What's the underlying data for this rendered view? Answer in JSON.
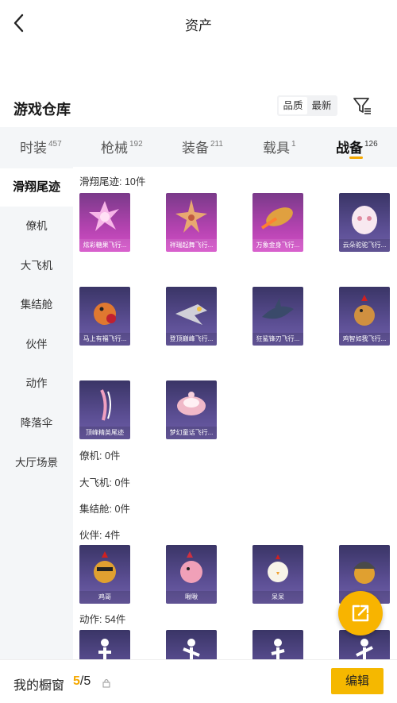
{
  "header": {
    "title": "资产"
  },
  "section": {
    "title": "游戏仓库",
    "sort_options": [
      "品质",
      "最新"
    ],
    "active_sort": "品质"
  },
  "tabs": [
    {
      "label": "时装",
      "count": "457"
    },
    {
      "label": "枪械",
      "count": "192"
    },
    {
      "label": "装备",
      "count": "211"
    },
    {
      "label": "载具",
      "count": "1"
    },
    {
      "label": "战备",
      "count": "126",
      "active": true
    }
  ],
  "sidebar": {
    "items": [
      "滑翔尾迹",
      "僚机",
      "大飞机",
      "集结舱",
      "伙伴",
      "动作",
      "降落伞",
      "大厅场景"
    ],
    "active": "滑翔尾迹"
  },
  "groups": {
    "trail": {
      "label": "滑翔尾迹: 10件",
      "items": [
        "炫彩糖果飞行...",
        "祥瑞起舞飞行...",
        "万象金身飞行...",
        "云朵驼驼飞行...",
        "马上有福飞行...",
        "登顶巅峰飞行...",
        "狂鲨锋刃飞行...",
        "鸡智如我飞行...",
        "顶峰精英尾迹",
        "梦幻童话飞行..."
      ]
    },
    "wingman": {
      "label": "僚机: 0件"
    },
    "bigplane": {
      "label": "大飞机: 0件"
    },
    "pod": {
      "label": "集结舱: 0件"
    },
    "partner": {
      "label": "伙伴: 4件",
      "items": [
        "鸡哥",
        "啾啾",
        "呆呆",
        ""
      ]
    },
    "emote": {
      "label": "动作: 54件"
    }
  },
  "bottom": {
    "showcase_label": "我的橱窗",
    "count_current": "5",
    "count_total": "/5",
    "edit_label": "编辑"
  },
  "colors": {
    "accent": "#f5a800",
    "card_pink": "#b443b0",
    "card_purple": "#5b4e93"
  }
}
